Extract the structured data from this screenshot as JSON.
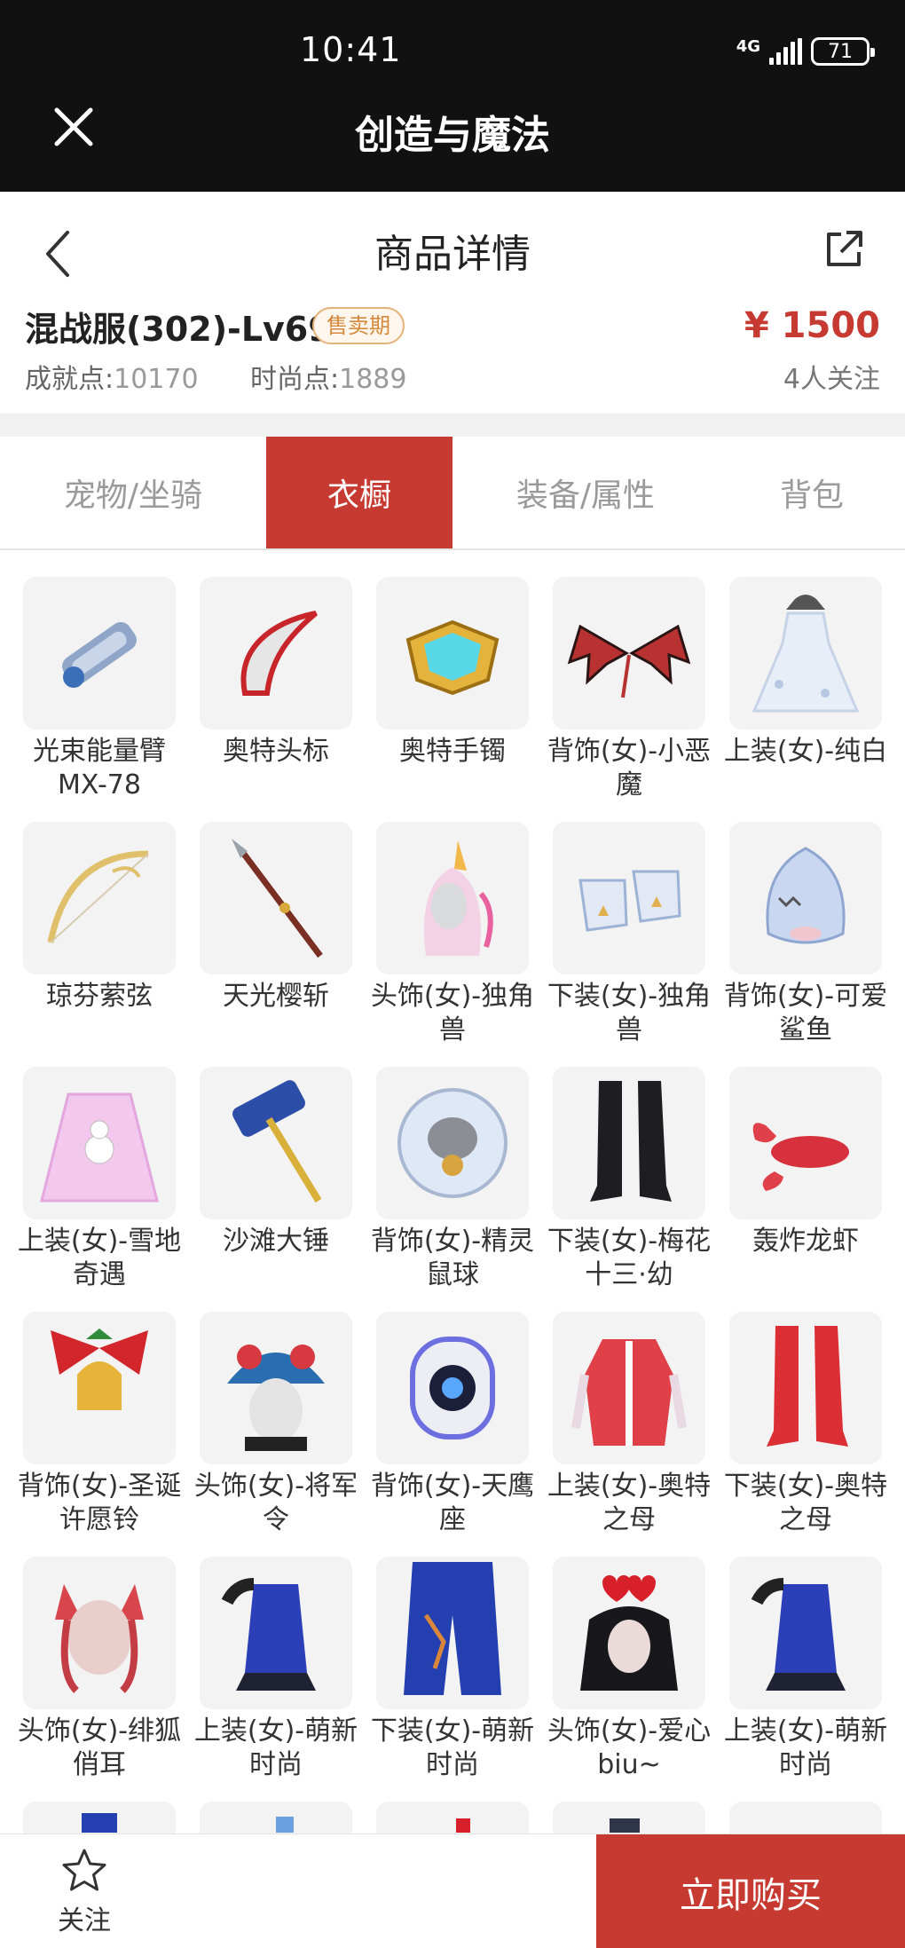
{
  "status_bar": {
    "time": "10:41",
    "network": "4G",
    "battery": "71"
  },
  "app": {
    "title": "创造与魔法"
  },
  "page": {
    "title": "商品详情"
  },
  "account": {
    "name": "混战服(302)-Lv69",
    "badge": "售卖期",
    "price": "¥ 1500",
    "achievement_label": "成就点:",
    "achievement_value": "10170",
    "fashion_label": "时尚点:",
    "fashion_value": "1889",
    "followers": "4人关注"
  },
  "tabs": [
    {
      "label": "宠物/坐骑",
      "active": false
    },
    {
      "label": "衣橱",
      "active": true
    },
    {
      "label": "装备/属性",
      "active": false
    },
    {
      "label": "背包",
      "active": false
    }
  ],
  "items": [
    {
      "label": "光束能量臂MX-78",
      "icon": "arm-cannon-icon"
    },
    {
      "label": "奥特头标",
      "icon": "head-crest-icon"
    },
    {
      "label": "奥特手镯",
      "icon": "bracelet-icon"
    },
    {
      "label": "背饰(女)-小恶魔",
      "icon": "devil-wings-icon"
    },
    {
      "label": "上装(女)-纯白",
      "icon": "white-dress-icon"
    },
    {
      "label": "琼芬萦弦",
      "icon": "bow-icon"
    },
    {
      "label": "天光樱斩",
      "icon": "spear-icon"
    },
    {
      "label": "头饰(女)-独角兽",
      "icon": "unicorn-hood-icon"
    },
    {
      "label": "下装(女)-独角兽",
      "icon": "unicorn-shoes-icon"
    },
    {
      "label": "背饰(女)-可爱鲨鱼",
      "icon": "shark-icon"
    },
    {
      "label": "上装(女)-雪地奇遇",
      "icon": "snow-dress-icon"
    },
    {
      "label": "沙滩大锤",
      "icon": "hammer-icon"
    },
    {
      "label": "背饰(女)-精灵鼠球",
      "icon": "mouse-ball-icon"
    },
    {
      "label": "下装(女)-梅花十三·幼",
      "icon": "black-boots-icon"
    },
    {
      "label": "轰炸龙虾",
      "icon": "lobster-icon"
    },
    {
      "label": "背饰(女)-圣诞许愿铃",
      "icon": "christmas-bell-icon"
    },
    {
      "label": "头饰(女)-将军令",
      "icon": "opera-headdress-icon"
    },
    {
      "label": "背饰(女)-天鹰座",
      "icon": "robot-backpack-icon"
    },
    {
      "label": "上装(女)-奥特之母",
      "icon": "red-top-icon"
    },
    {
      "label": "下装(女)-奥特之母",
      "icon": "red-boots-icon"
    },
    {
      "label": "头饰(女)-绯狐俏耳",
      "icon": "fox-ears-icon"
    },
    {
      "label": "上装(女)-萌新时尚",
      "icon": "blue-top-icon"
    },
    {
      "label": "下装(女)-萌新时尚",
      "icon": "blue-pants-icon"
    },
    {
      "label": "头饰(女)-爱心biu~",
      "icon": "heart-headband-icon"
    },
    {
      "label": "上装(女)-萌新时尚",
      "icon": "blue-top-icon"
    }
  ],
  "bottom": {
    "follow_label": "关注",
    "buy_label": "立即购买"
  },
  "colors": {
    "accent": "#c63a32",
    "badge": "#d6893c",
    "topbar": "#111111"
  }
}
